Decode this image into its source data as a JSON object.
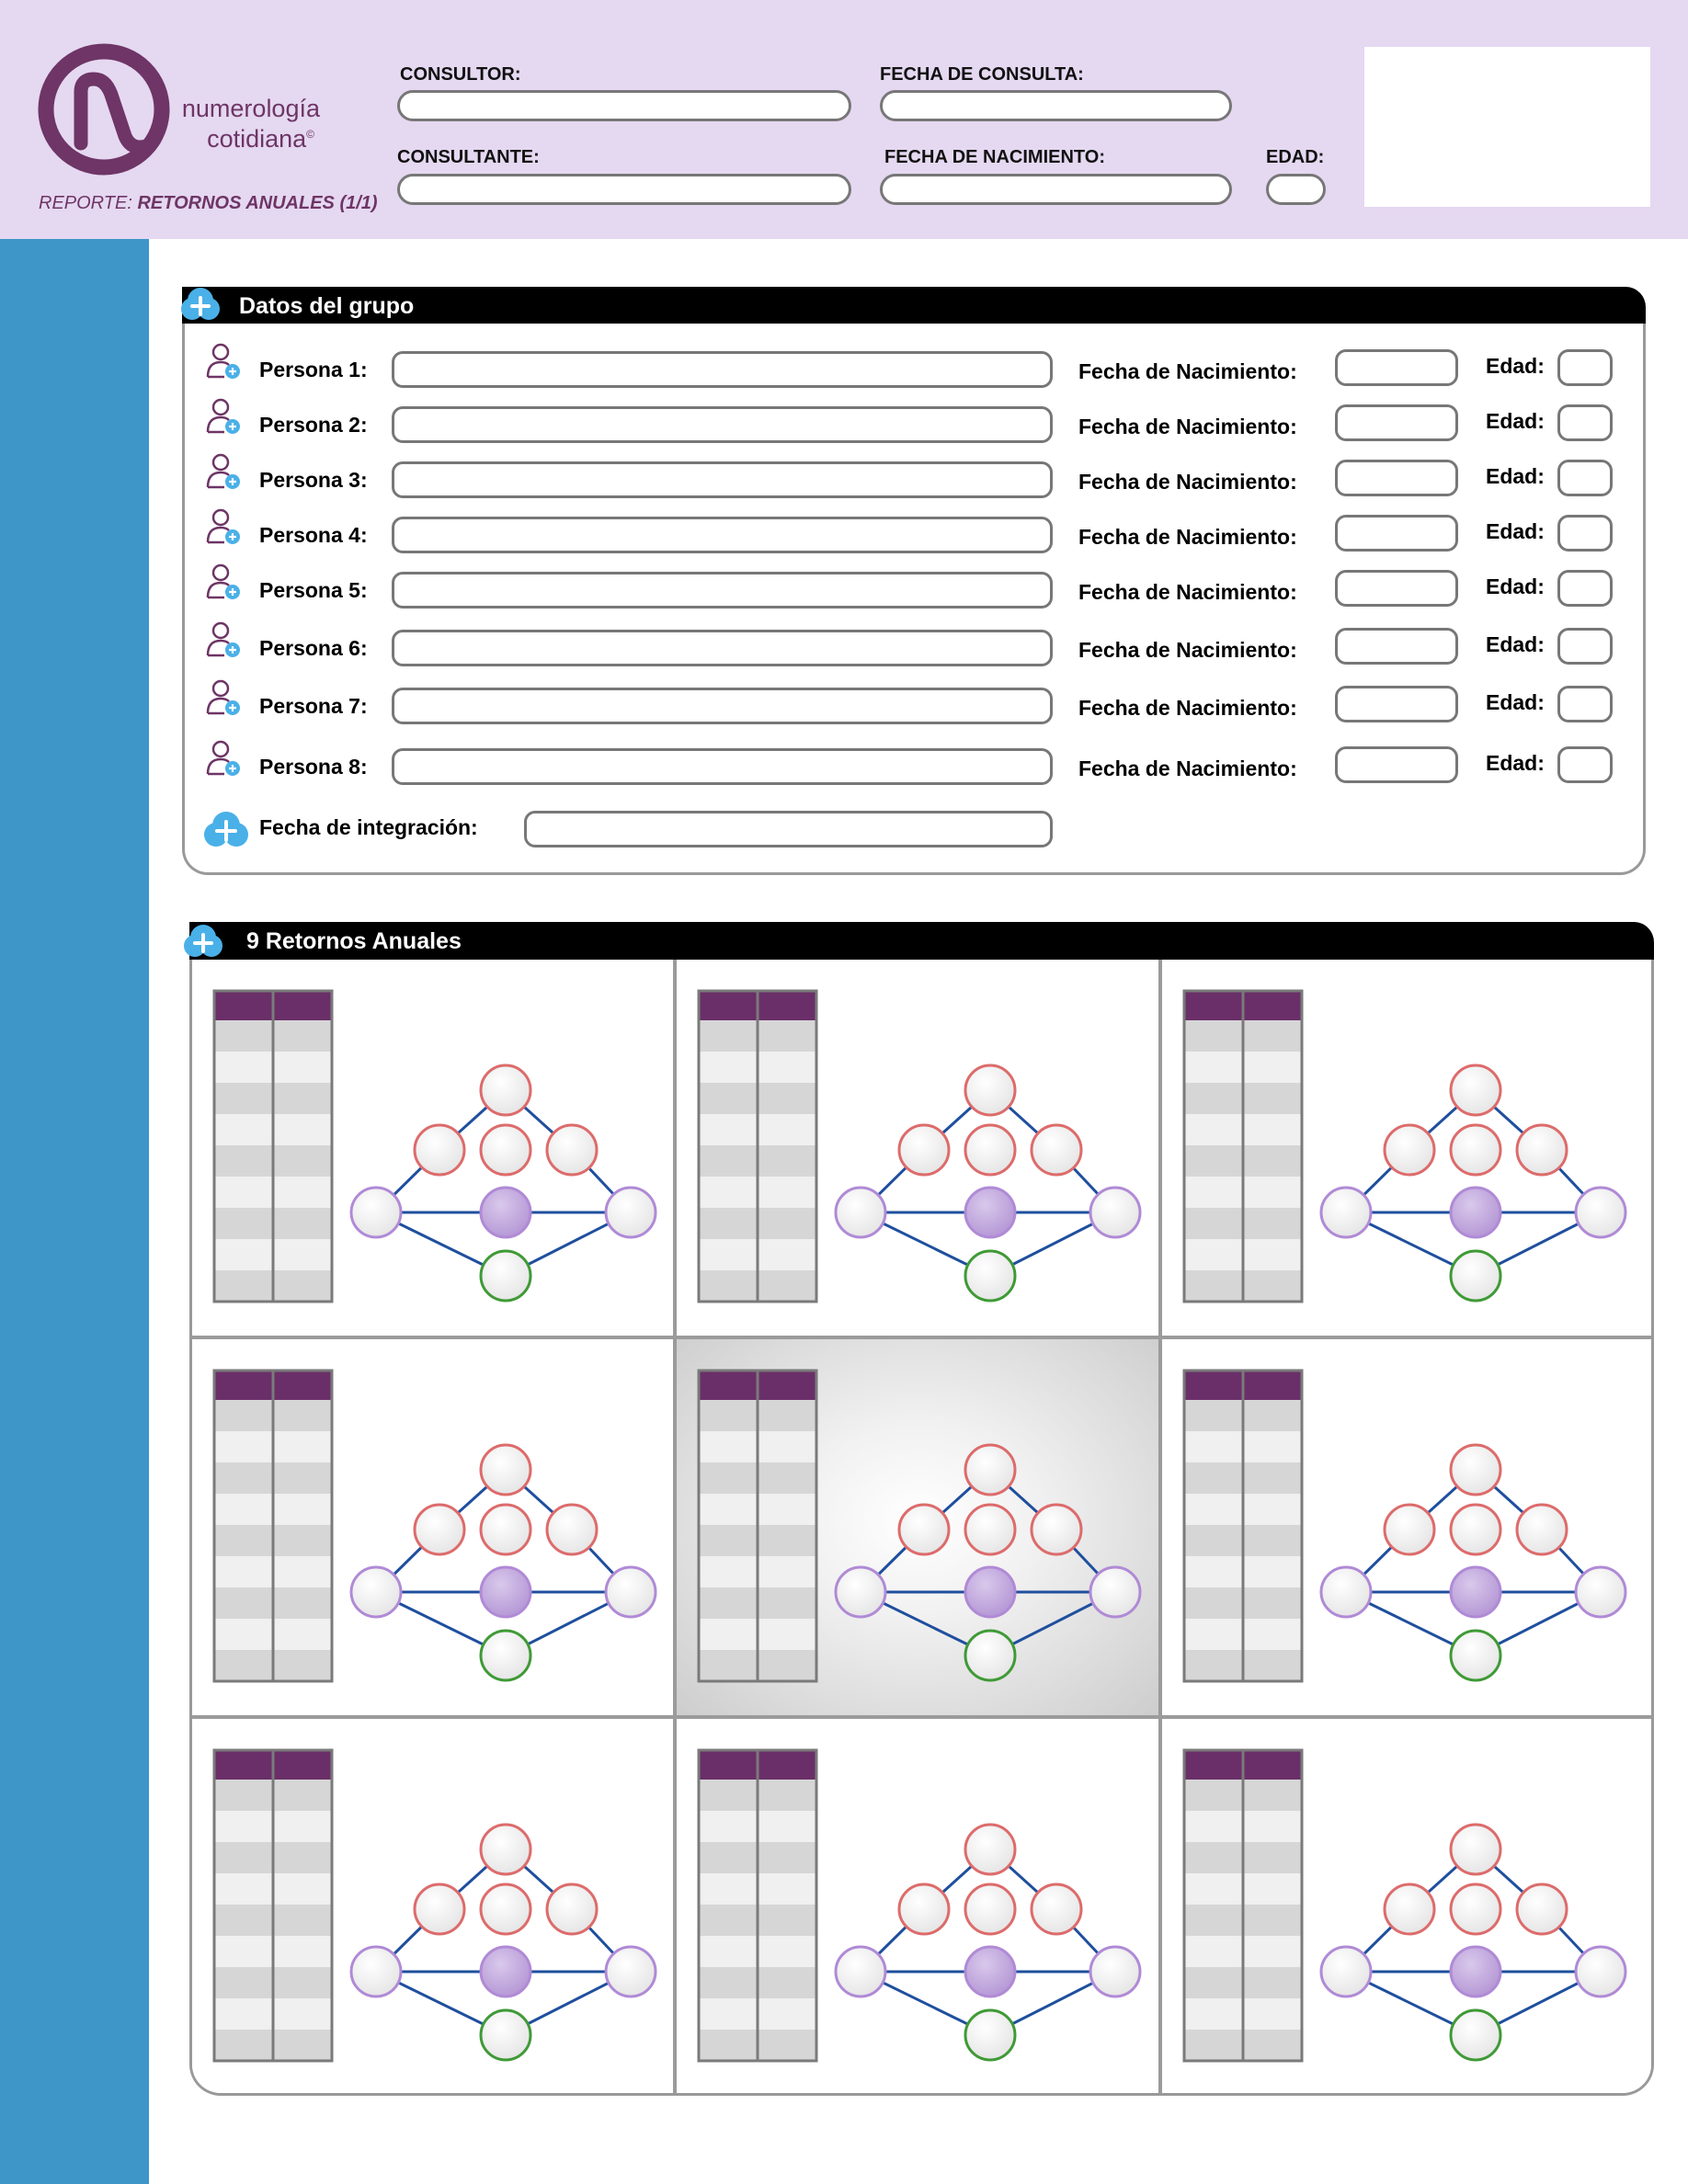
{
  "brand": {
    "line1": "numerología",
    "line2": "cotidiana",
    "mark": "©",
    "colors": {
      "purple": "#6e3566",
      "header_bg": "#e5d8f1",
      "side_blue": "#3e95c7",
      "cloud_blue": "#4ab0e8"
    }
  },
  "report": {
    "prefix": "REPORTE:",
    "name": "RETORNOS ANUALES (1/1)"
  },
  "header_fields": {
    "consultor": "CONSULTOR:",
    "fecha_consulta": "FECHA DE CONSULTA:",
    "consultante": "CONSULTANTE:",
    "fecha_nacimiento": "FECHA DE NACIMIENTO:",
    "edad": "EDAD:"
  },
  "group": {
    "title": "Datos del grupo",
    "birth_label": "Fecha de Nacimiento:",
    "age_label": "Edad:",
    "persons": [
      "Persona 1:",
      "Persona 2:",
      "Persona 3:",
      "Persona 4:",
      "Persona 5:",
      "Persona 6:",
      "Persona 7:",
      "Persona 8:"
    ],
    "integration_label": "Fecha de integración:",
    "icons": {
      "person": "person-add-icon",
      "cloud": "cloud-add-icon"
    }
  },
  "returns": {
    "title": "9 Retornos Anuales",
    "count": 9,
    "highlighted_index": 4,
    "node_colors": {
      "red_ring": "#dd6b6b",
      "purple_ring": "#b08ad6",
      "green_ring": "#3f9a36",
      "center_fill": "#c7b0df",
      "edge": "#1f4f9e",
      "table_head": "#6a2f68"
    }
  }
}
